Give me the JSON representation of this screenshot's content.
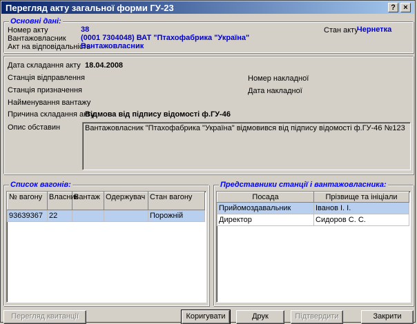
{
  "window": {
    "title": "Перегляд акту загальної форми ГУ-23",
    "help_label": "?",
    "close_label": "×"
  },
  "main_info": {
    "group_title": "Основні дані:",
    "act_number_label": "Номер акту",
    "act_number": "38",
    "owner_label": "Вантажовласник",
    "owner": "(0001 7304048) ВАТ \"Птахофабрика \"Україна\"",
    "responsible_label": "Акт на відповідальність",
    "responsible": "Вантажовласник",
    "state_label": "Стан акту",
    "state": "Чернетка"
  },
  "details": {
    "date_label": "Дата складання акту",
    "date": "18.04.2008",
    "departure_label": "Станція відправлення",
    "destination_label": "Станція призначення",
    "cargo_label": "Найменування вантажу",
    "waybill_number_label": "Номер накладної",
    "waybill_date_label": "Дата накладної",
    "reason_label": "Причина складання акту",
    "reason": "Відмова від підпису відомості ф.ГУ-46",
    "description_label": "Опис обставин",
    "description": "Вантажовласник \"Птахофабрика \"Україна\" відмовився від підпису відомості ф.ГУ-46 №123"
  },
  "wagons": {
    "group_title": "Список вагонів:",
    "columns": [
      "№ вагону",
      "Власник",
      "Вантаж",
      "Одержувач",
      "Стан вагону"
    ],
    "rows": [
      [
        "93639367",
        "22",
        "",
        "",
        "Порожній"
      ]
    ]
  },
  "representatives": {
    "group_title": "Представники станції і вантажовласника:",
    "columns": [
      "Посада",
      "Прізвище та ініціали"
    ],
    "rows": [
      [
        "Прийомоздавальник",
        "Іванов І. І."
      ],
      [
        "Директор",
        "Сидоров С. С."
      ]
    ]
  },
  "buttons": {
    "receipt": "Перегляд квитанції",
    "edit": "Коригувати",
    "print": "Друк",
    "confirm": "Підтвердити",
    "close": "Закрити"
  }
}
